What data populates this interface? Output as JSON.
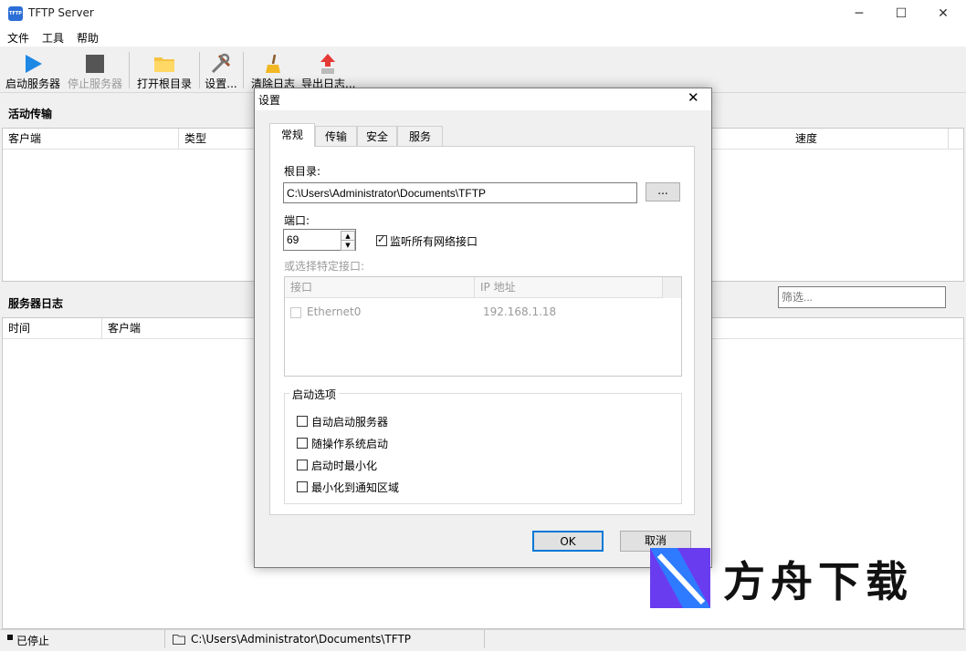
{
  "window": {
    "title": "TFTP Server",
    "app_icon_text": "TFTP"
  },
  "menu": {
    "items": [
      "文件",
      "工具",
      "帮助"
    ]
  },
  "toolbar": {
    "start_label": "启动服务器",
    "stop_label": "停止服务器",
    "open_root_label": "打开根目录",
    "settings_label": "设置...",
    "clear_log_label": "清除日志",
    "export_log_label": "导出日志..."
  },
  "active_transfers": {
    "title": "活动传输",
    "columns": [
      "客户端",
      "类型",
      "速度"
    ]
  },
  "server_log": {
    "title": "服务器日志",
    "filter_placeholder": "筛选...",
    "columns": [
      "时间",
      "客户端"
    ]
  },
  "statusbar": {
    "status": "已停止",
    "path": "C:\\Users\\Administrator\\Documents\\TFTP"
  },
  "dialog": {
    "title": "设置",
    "tabs": [
      "常规",
      "传输",
      "安全",
      "服务"
    ],
    "root_label": "根目录:",
    "root_value": "C:\\Users\\Administrator\\Documents\\TFTP",
    "browse_label": "...",
    "port_label": "端口:",
    "port_value": "69",
    "listen_all_label": "监听所有网络接口",
    "listen_all_checked": true,
    "select_iface_label": "或选择特定接口:",
    "iface_columns": [
      "接口",
      "IP 地址"
    ],
    "interfaces": [
      {
        "name": "Ethernet0",
        "ip": "192.168.1.18"
      }
    ],
    "startup_group_title": "启动选项",
    "startup_options": [
      "自动启动服务器",
      "随操作系统启动",
      "启动时最小化",
      "最小化到通知区域"
    ],
    "ok_label": "OK",
    "cancel_label": "取消"
  },
  "watermark": {
    "text": "方舟下载"
  },
  "colors": {
    "accent": "#2b6fd6",
    "play": "#1e88e5",
    "stop": "#555555"
  }
}
